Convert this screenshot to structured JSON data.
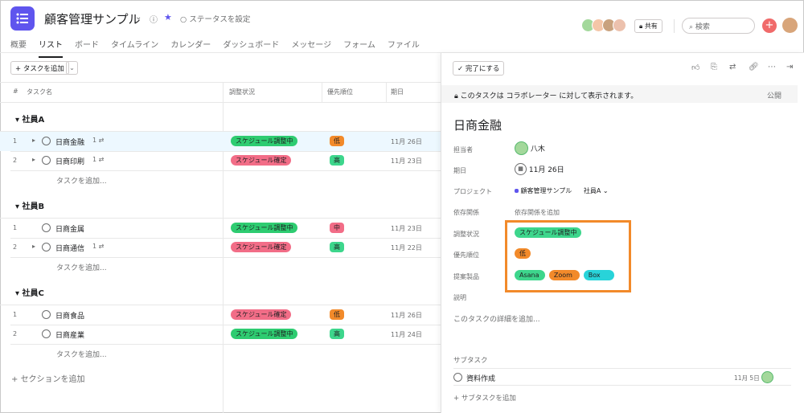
{
  "project": {
    "title": "顧客管理サンプル",
    "status_label": "ステータスを設定"
  },
  "colors": {
    "accent": "#5f55ee",
    "green": "#2ecc71",
    "pink": "#f26d87",
    "orange": "#f28a2a",
    "lightgreen": "#3dd68c",
    "teal": "#28d3d9"
  },
  "tabs": [
    "概要",
    "リスト",
    "ボード",
    "タイムライン",
    "カレンダー",
    "ダッシュボード",
    "メッセージ",
    "フォーム",
    "ファイル"
  ],
  "toolbar": {
    "share": "共有",
    "search_placeholder": "検索",
    "add_task": "タスクを追加"
  },
  "columns": {
    "num": "#",
    "name": "タスク名",
    "adjust": "調整状況",
    "priority": "優先順位",
    "due": "期日"
  },
  "sections": [
    {
      "name": "社員A",
      "add_label": "タスクを追加...",
      "rows": [
        {
          "num": "1",
          "name": "日商金融",
          "sub": "1",
          "status": "スケジュール調整中",
          "status_kind": "green",
          "priority": "低",
          "pri_kind": "orange",
          "due": "11月 26日",
          "expand": true,
          "selected": true
        },
        {
          "num": "2",
          "name": "日商印刷",
          "sub": "1",
          "status": "スケジュール確定",
          "status_kind": "pink",
          "priority": "高",
          "pri_kind": "green",
          "due": "11月 23日",
          "expand": true,
          "selected": false
        }
      ]
    },
    {
      "name": "社員B",
      "add_label": "タスクを追加...",
      "rows": [
        {
          "num": "1",
          "name": "日商金属",
          "sub": "",
          "status": "スケジュール調整中",
          "status_kind": "green",
          "priority": "中",
          "pri_kind": "pink",
          "due": "11月 23日",
          "expand": false,
          "selected": false
        },
        {
          "num": "2",
          "name": "日商通信",
          "sub": "1",
          "status": "スケジュール確定",
          "status_kind": "pink",
          "priority": "高",
          "pri_kind": "green",
          "due": "11月 22日",
          "expand": true,
          "selected": false
        }
      ]
    },
    {
      "name": "社員C",
      "add_label": "タスクを追加...",
      "rows": [
        {
          "num": "1",
          "name": "日商食品",
          "sub": "",
          "status": "スケジュール確定",
          "status_kind": "pink",
          "priority": "低",
          "pri_kind": "orange",
          "due": "11月 26日",
          "expand": false,
          "selected": false
        },
        {
          "num": "2",
          "name": "日商産業",
          "sub": "",
          "status": "スケジュール調整中",
          "status_kind": "green",
          "priority": "高",
          "pri_kind": "green",
          "due": "11月 24日",
          "expand": false,
          "selected": false
        }
      ]
    }
  ],
  "add_section": "セクションを追加",
  "detail": {
    "complete_label": "完了にする",
    "banner_text": "このタスクは コラボレーター に対して表示されます。",
    "banner_public": "公開",
    "title": "日商金融",
    "fields": {
      "assignee_label": "担当者",
      "assignee_value": "八木",
      "due_label": "期日",
      "due_value": "11月 26日",
      "project_label": "プロジェクト",
      "project_value": "顧客管理サンプル",
      "project_section": "社員A",
      "dependency_label": "依存関係",
      "dependency_value": "依存関係を追加",
      "adjust_label": "調整状況",
      "adjust_value": "スケジュール調整中",
      "priority_label": "優先順位",
      "priority_value": "低",
      "product_label": "提案製品",
      "products": [
        "Asana",
        "Zoom",
        "Box"
      ],
      "desc_label": "説明",
      "desc_placeholder": "このタスクの詳細を追加..."
    },
    "subtasks_header": "サブタスク",
    "subtask": {
      "name": "資料作成",
      "due": "11月 5日"
    },
    "add_subtask": "サブタスクを追加"
  }
}
